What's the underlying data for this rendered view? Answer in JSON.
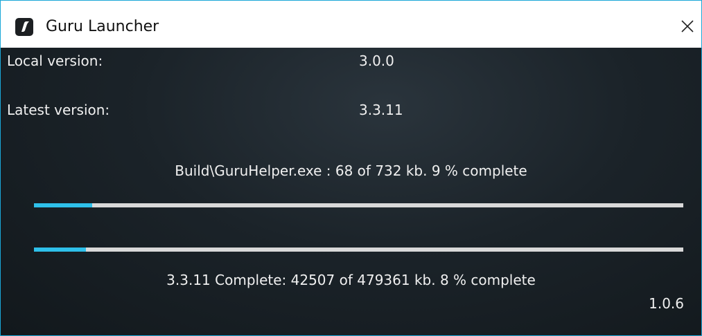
{
  "window": {
    "title": "Guru Launcher",
    "icon": "guru-app-icon",
    "close_icon": "close-icon",
    "accent_color": "#1aa7d8"
  },
  "versions": {
    "local_label": "Local version:",
    "local_value": "3.0.0",
    "latest_label": "Latest version:",
    "latest_value": "3.3.11"
  },
  "file_progress": {
    "text": "Build\\GuruHelper.exe : 68 of 732 kb.  9 % complete",
    "percent": 9,
    "fill_color": "#2ec0ea"
  },
  "total_progress": {
    "text": "3.3.11 Complete: 42507 of 479361 kb.  8 % complete",
    "percent": 8,
    "fill_color": "#2ec0ea"
  },
  "launcher_version": "1.0.6"
}
